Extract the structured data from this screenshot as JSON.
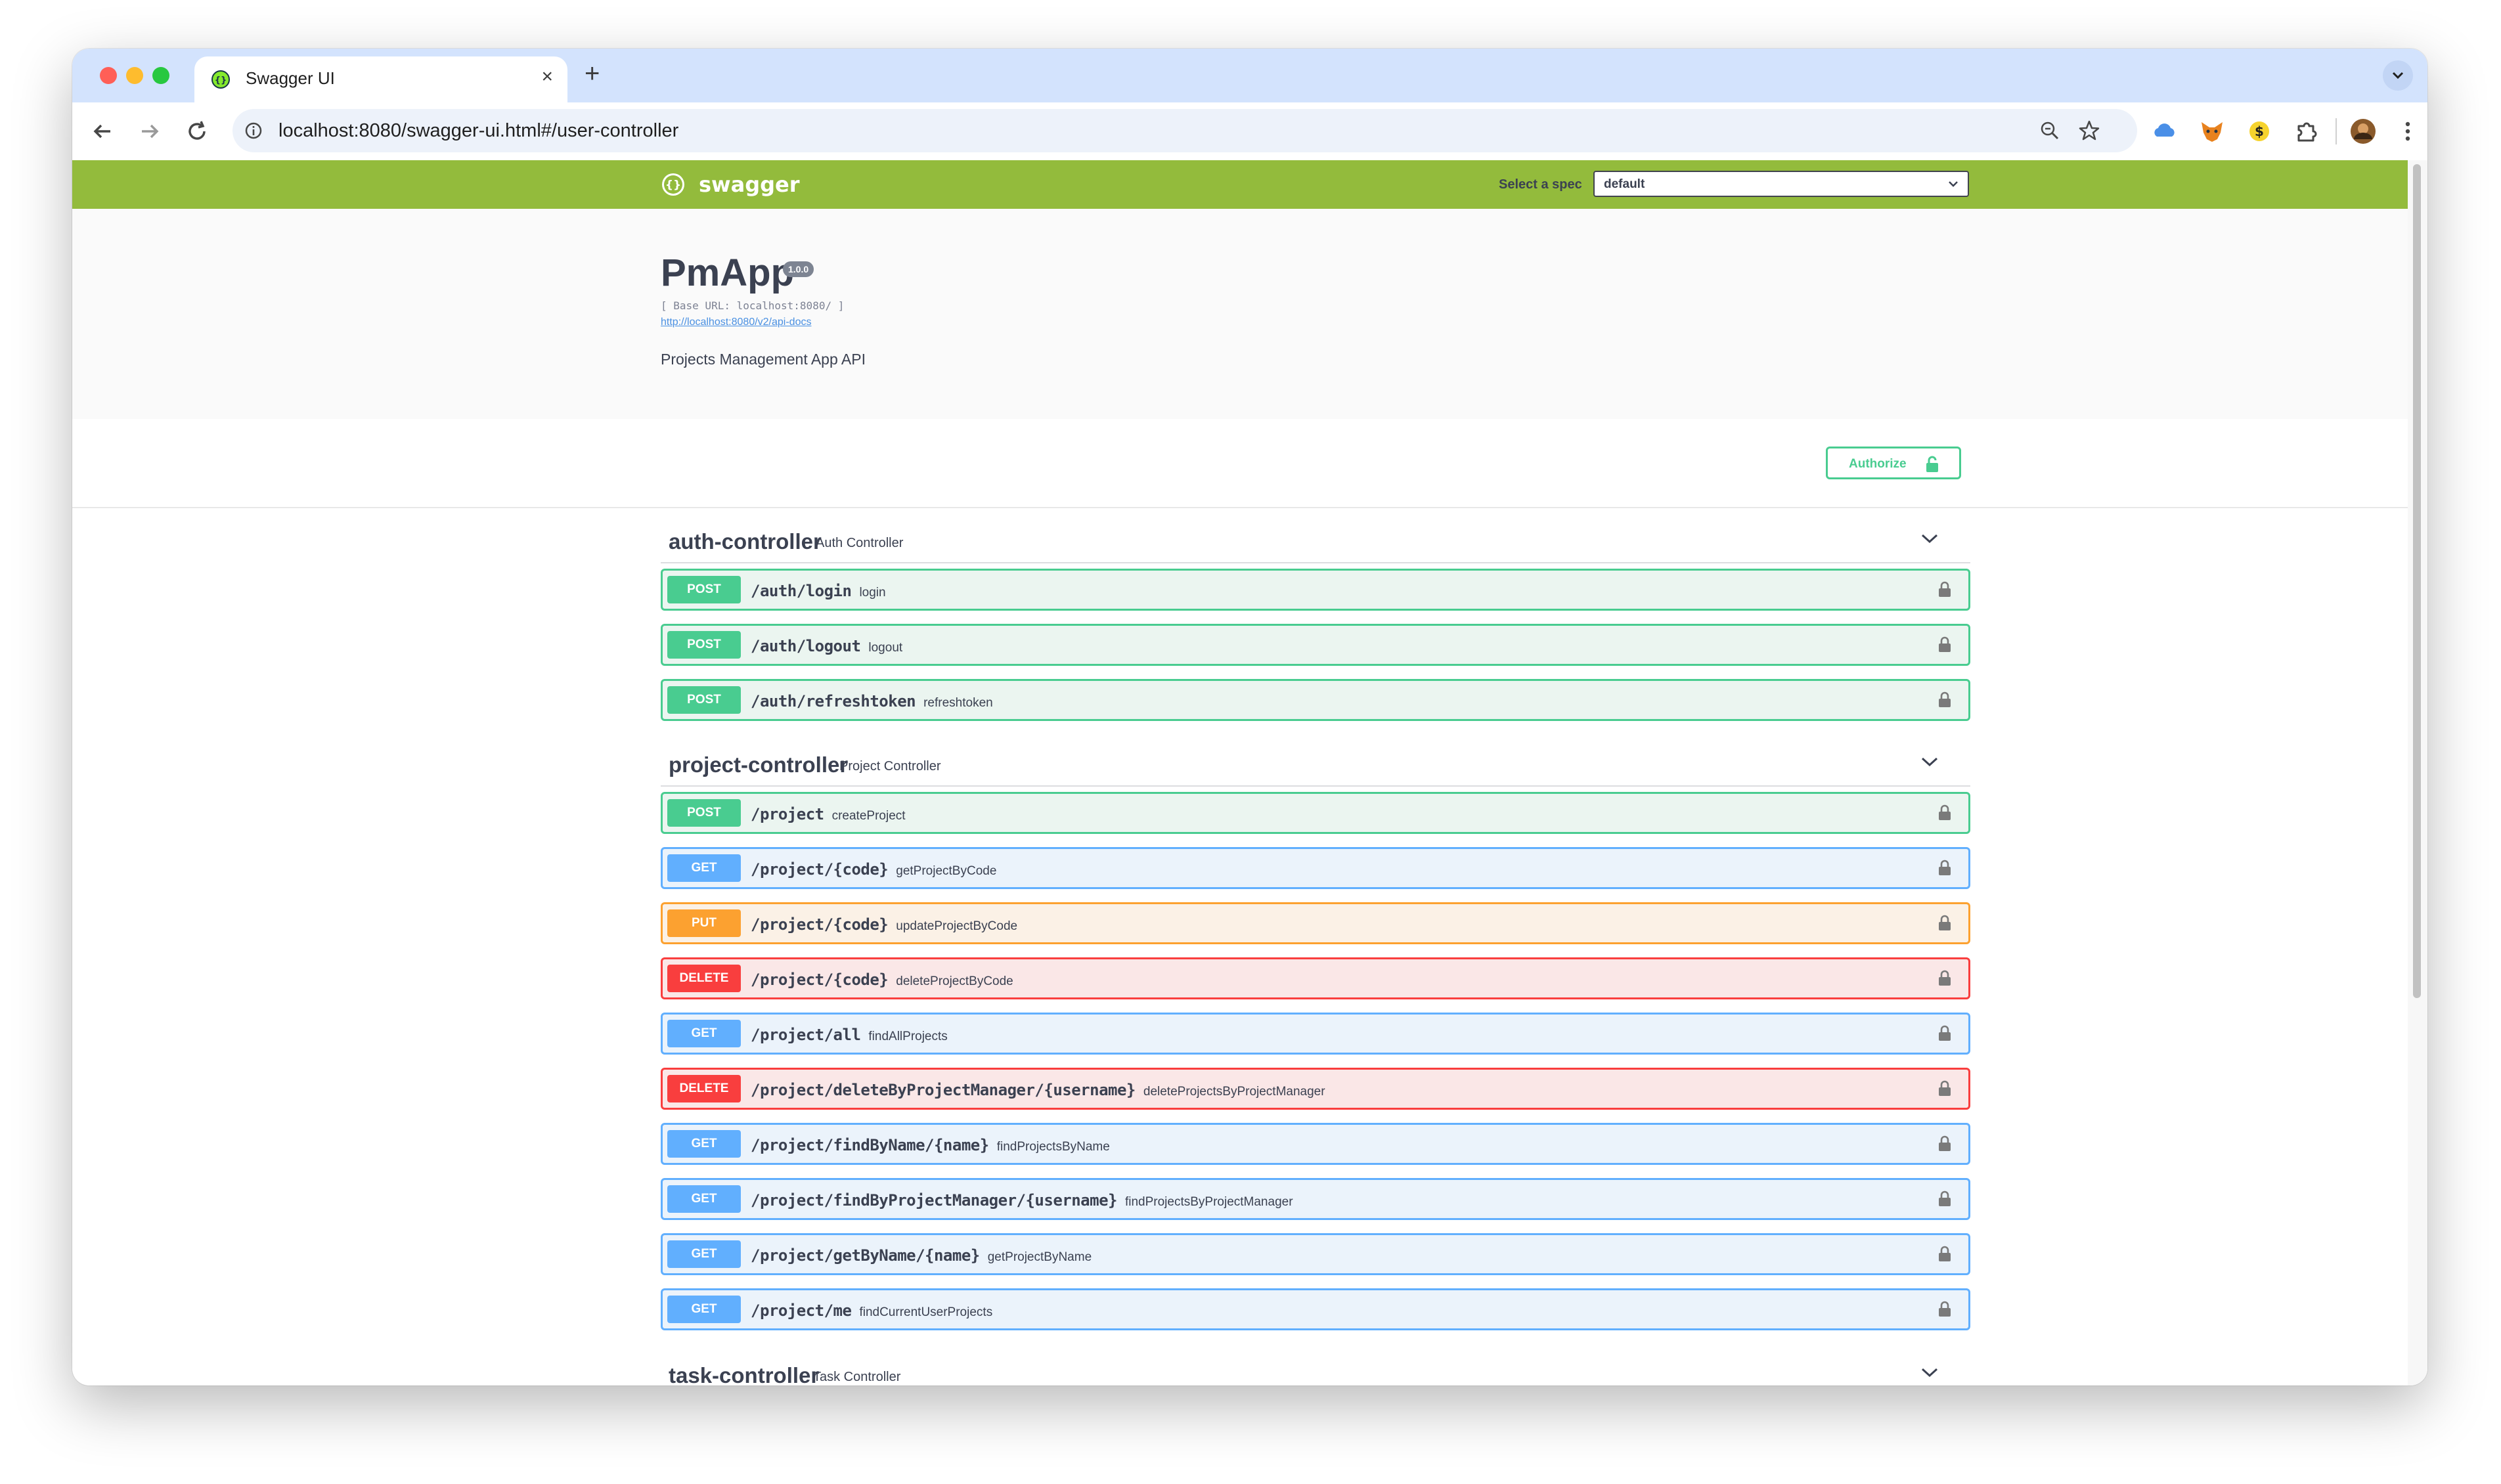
{
  "browser": {
    "tab_title": "Swagger UI",
    "tab_close": "×",
    "new_tab": "+",
    "url": "localhost:8080/swagger-ui.html#/user-controller"
  },
  "swagger": {
    "logo_text": "swagger",
    "spec_label": "Select a spec",
    "spec_value": "default",
    "title": "PmApp",
    "version": "1.0.0",
    "base_url": "[ Base URL: localhost:8080/ ]",
    "api_docs_link": "http://localhost:8080/v2/api-docs",
    "description": "Projects Management App API",
    "authorize_label": "Authorize"
  },
  "tags": [
    {
      "name": "auth-controller",
      "description": "Auth Controller",
      "operations": [
        {
          "method": "POST",
          "path": "/auth/login",
          "op_id": "login"
        },
        {
          "method": "POST",
          "path": "/auth/logout",
          "op_id": "logout"
        },
        {
          "method": "POST",
          "path": "/auth/refreshtoken",
          "op_id": "refreshtoken"
        }
      ]
    },
    {
      "name": "project-controller",
      "description": "Project Controller",
      "operations": [
        {
          "method": "POST",
          "path": "/project",
          "op_id": "createProject"
        },
        {
          "method": "GET",
          "path": "/project/{code}",
          "op_id": "getProjectByCode"
        },
        {
          "method": "PUT",
          "path": "/project/{code}",
          "op_id": "updateProjectByCode"
        },
        {
          "method": "DELETE",
          "path": "/project/{code}",
          "op_id": "deleteProjectByCode"
        },
        {
          "method": "GET",
          "path": "/project/all",
          "op_id": "findAllProjects"
        },
        {
          "method": "DELETE",
          "path": "/project/deleteByProjectManager/{username}",
          "op_id": "deleteProjectsByProjectManager"
        },
        {
          "method": "GET",
          "path": "/project/findByName/{name}",
          "op_id": "findProjectsByName"
        },
        {
          "method": "GET",
          "path": "/project/findByProjectManager/{username}",
          "op_id": "findProjectsByProjectManager"
        },
        {
          "method": "GET",
          "path": "/project/getByName/{name}",
          "op_id": "getProjectByName"
        },
        {
          "method": "GET",
          "path": "/project/me",
          "op_id": "findCurrentUserProjects"
        }
      ]
    },
    {
      "name": "task-controller",
      "description": "Task Controller",
      "operations": []
    }
  ],
  "colors": {
    "post": "#49cc90",
    "get": "#61affe",
    "put": "#fca130",
    "delete": "#f93e3e",
    "topbar": "#93bb3c"
  }
}
